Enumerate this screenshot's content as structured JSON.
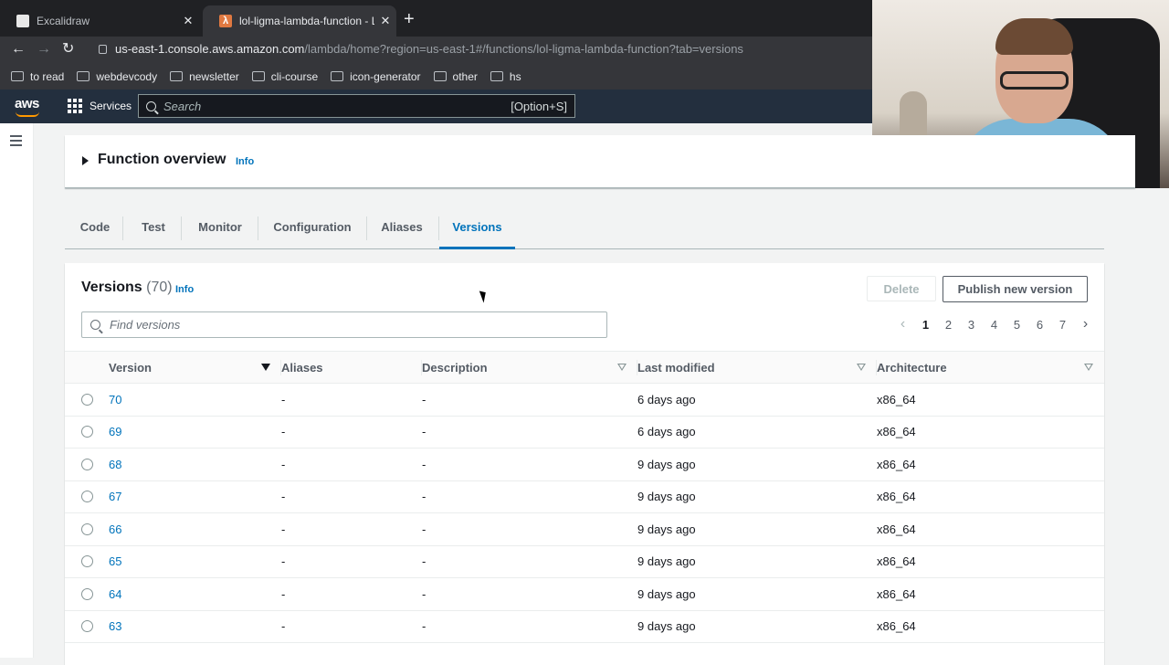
{
  "browser": {
    "tabs": [
      {
        "title": "Excalidraw",
        "close": "✕"
      },
      {
        "title": "lol-ligma-lambda-function - La",
        "close": "✕"
      }
    ],
    "new_tab": "+",
    "url_host": "us-east-1.console.aws.amazon.com",
    "url_path": "/lambda/home?region=us-east-1#/functions/lol-ligma-lambda-function?tab=versions",
    "bookmarks": [
      "to read",
      "webdevcody",
      "newsletter",
      "cli-course",
      "icon-generator",
      "other",
      "hs"
    ]
  },
  "aws": {
    "logo": "aws",
    "services": "Services",
    "search_placeholder": "Search",
    "search_shortcut": "[Option+S]"
  },
  "overview": {
    "title": "Function overview",
    "info": "Info"
  },
  "function_tabs": [
    "Code",
    "Test",
    "Monitor",
    "Configuration",
    "Aliases",
    "Versions"
  ],
  "active_tab": "Versions",
  "versions": {
    "title": "Versions",
    "count": "(70)",
    "info": "Info",
    "delete_label": "Delete",
    "publish_label": "Publish new version",
    "find_placeholder": "Find versions",
    "pages": [
      "1",
      "2",
      "3",
      "4",
      "5",
      "6",
      "7"
    ],
    "current_page": "1",
    "columns": [
      "Version",
      "Aliases",
      "Description",
      "Last modified",
      "Architecture"
    ],
    "rows": [
      {
        "version": "70",
        "aliases": "-",
        "description": "-",
        "modified": "6 days ago",
        "arch": "x86_64"
      },
      {
        "version": "69",
        "aliases": "-",
        "description": "-",
        "modified": "6 days ago",
        "arch": "x86_64"
      },
      {
        "version": "68",
        "aliases": "-",
        "description": "-",
        "modified": "9 days ago",
        "arch": "x86_64"
      },
      {
        "version": "67",
        "aliases": "-",
        "description": "-",
        "modified": "9 days ago",
        "arch": "x86_64"
      },
      {
        "version": "66",
        "aliases": "-",
        "description": "-",
        "modified": "9 days ago",
        "arch": "x86_64"
      },
      {
        "version": "65",
        "aliases": "-",
        "description": "-",
        "modified": "9 days ago",
        "arch": "x86_64"
      },
      {
        "version": "64",
        "aliases": "-",
        "description": "-",
        "modified": "9 days ago",
        "arch": "x86_64"
      },
      {
        "version": "63",
        "aliases": "-",
        "description": "-",
        "modified": "9 days ago",
        "arch": "x86_64"
      }
    ]
  },
  "colors": {
    "link": "#0073bb",
    "aws_nav": "#232f3e",
    "aws_accent": "#ff9900"
  }
}
